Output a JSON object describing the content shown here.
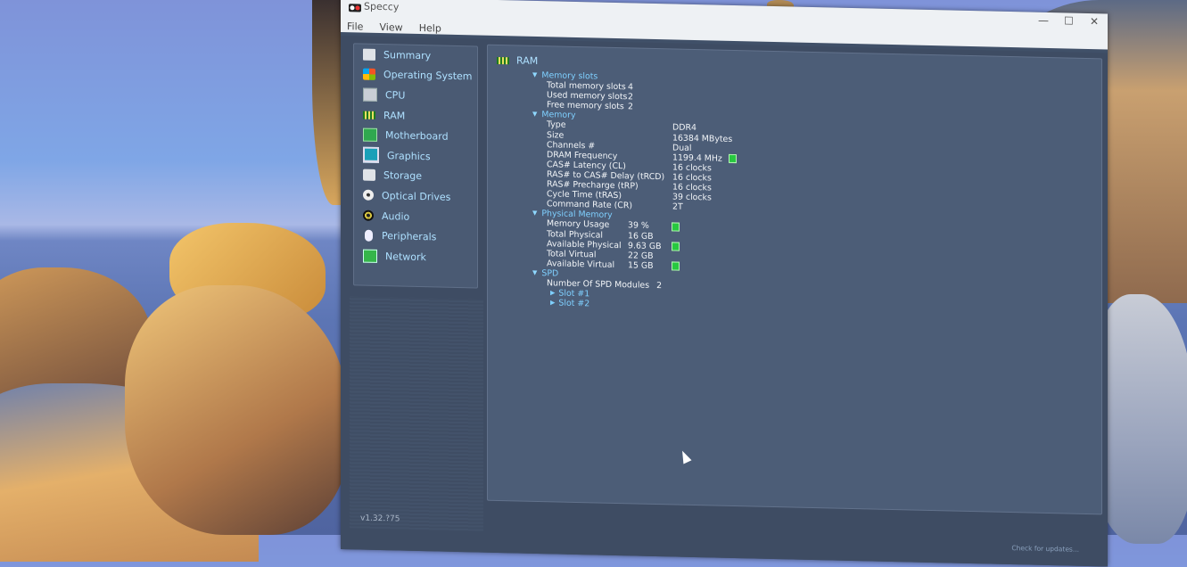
{
  "window": {
    "title": "Speccy",
    "menu": [
      "File",
      "View",
      "Help"
    ],
    "controls": {
      "minimize": "—",
      "maximize": "☐",
      "close": "✕"
    }
  },
  "sidebar": {
    "items": [
      {
        "label": "Summary",
        "icon": "clipboard-icon"
      },
      {
        "label": "Operating System",
        "icon": "windows-logo-icon"
      },
      {
        "label": "CPU",
        "icon": "cpu-icon"
      },
      {
        "label": "RAM",
        "icon": "ram-icon"
      },
      {
        "label": "Motherboard",
        "icon": "motherboard-icon"
      },
      {
        "label": "Graphics",
        "icon": "monitor-icon"
      },
      {
        "label": "Storage",
        "icon": "hard-drive-icon"
      },
      {
        "label": "Optical Drives",
        "icon": "disc-icon"
      },
      {
        "label": "Audio",
        "icon": "speaker-icon"
      },
      {
        "label": "Peripherals",
        "icon": "mouse-icon"
      },
      {
        "label": "Network",
        "icon": "network-card-icon"
      }
    ],
    "selected": "RAM"
  },
  "content": {
    "heading": "RAM",
    "memory_slots": {
      "title": "Memory slots",
      "rows": [
        {
          "k": "Total memory slots",
          "v": "4"
        },
        {
          "k": "Used memory slots",
          "v": "2"
        },
        {
          "k": "Free memory slots",
          "v": "2"
        }
      ]
    },
    "memory": {
      "title": "Memory",
      "rows": [
        {
          "k": "Type",
          "v": "DDR4"
        },
        {
          "k": "Size",
          "v": "16384 MBytes"
        },
        {
          "k": "Channels #",
          "v": "Dual"
        },
        {
          "k": "DRAM Frequency",
          "v": "1199.4 MHz"
        },
        {
          "k": "CAS# Latency (CL)",
          "v": "16 clocks"
        },
        {
          "k": "RAS# to CAS# Delay (tRCD)",
          "v": "16 clocks"
        },
        {
          "k": "RAS# Precharge (tRP)",
          "v": "16 clocks"
        },
        {
          "k": "Cycle Time (tRAS)",
          "v": "39 clocks"
        },
        {
          "k": "Command Rate (CR)",
          "v": "2T"
        }
      ]
    },
    "physical_memory": {
      "title": "Physical Memory",
      "rows": [
        {
          "k": "Memory Usage",
          "v": "39 %"
        },
        {
          "k": "Total Physical",
          "v": "16 GB"
        },
        {
          "k": "Available Physical",
          "v": "9.63 GB"
        },
        {
          "k": "Total Virtual",
          "v": "22 GB"
        },
        {
          "k": "Available Virtual",
          "v": "15 GB"
        }
      ]
    },
    "spd": {
      "title": "SPD",
      "modules_label": "Number Of SPD Modules",
      "modules_value": "2",
      "slots": [
        "Slot #1",
        "Slot #2"
      ]
    }
  },
  "footer": {
    "check_updates": "Check for updates...",
    "version": "v1.32.?75"
  },
  "colors": {
    "accent": "#aee0ff",
    "section": "#7fd0ff",
    "indicator": "#28c840",
    "panel": "#4c5d77"
  }
}
